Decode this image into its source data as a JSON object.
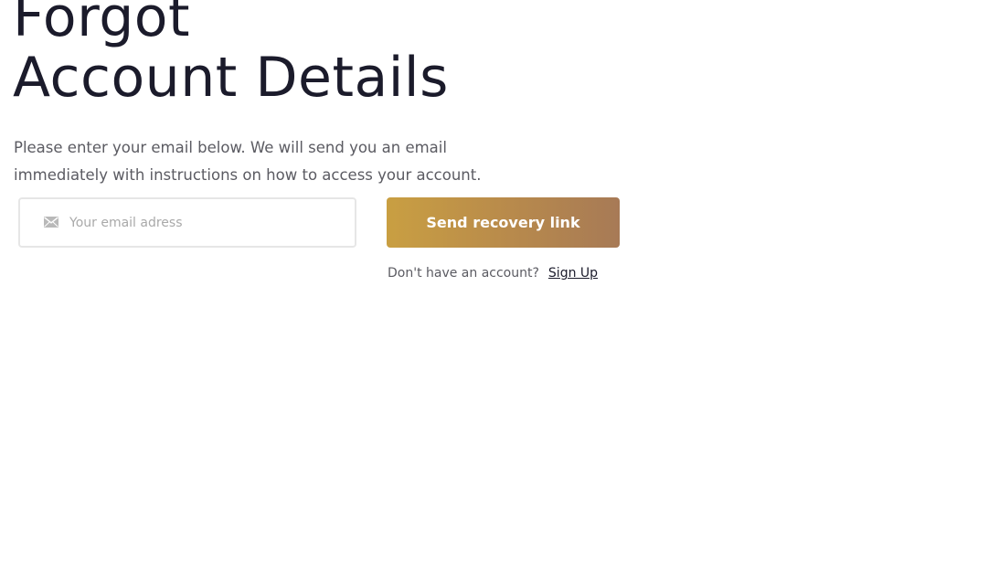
{
  "title": {
    "line1": "Forgot",
    "line2": "Account Details"
  },
  "description": "Please enter your email below. We will send you an email immediately with instructions on how to access your account.",
  "email": {
    "placeholder": "Your email adress",
    "value": "",
    "icon": "envelope-icon"
  },
  "send_button": {
    "label": "Send recovery link"
  },
  "signup": {
    "prompt": "Don't have an account?",
    "link_label": "Sign Up"
  },
  "colors": {
    "title": "#1b1b2b",
    "text": "#5b5b62",
    "button_gradient_start": "#c99f42",
    "button_gradient_end": "#a77a56"
  }
}
